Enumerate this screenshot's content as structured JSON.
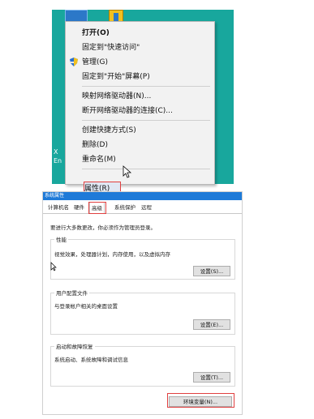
{
  "context_menu": {
    "items": [
      {
        "label": "打开(O)",
        "bold": true
      },
      {
        "label": "固定到\"快速访问\""
      },
      {
        "label": "管理(G)",
        "icon": "shield-icon"
      },
      {
        "label": "固定到\"开始\"屏幕(P)"
      },
      {
        "label": "映射网络驱动器(N)..."
      },
      {
        "label": "断开网络驱动器的连接(C)..."
      },
      {
        "label": "创建快捷方式(S)"
      },
      {
        "label": "删除(D)"
      },
      {
        "label": "重命名(M)"
      },
      {
        "label": "属性(R)",
        "highlighted": true
      }
    ]
  },
  "desktop": {
    "side_text_1": "X",
    "side_text_2": "En"
  },
  "dialog": {
    "title": "系统属性",
    "tabs": [
      {
        "label": "计算机名"
      },
      {
        "label": "硬件"
      },
      {
        "label": "高级",
        "active": true
      },
      {
        "label": "系统保护"
      },
      {
        "label": "远程"
      }
    ],
    "intro": "要进行大多数更改，你必须作为管理员登录。",
    "performance": {
      "title": "性能",
      "desc": "视觉效果，处理器计划，内存使用，以及虚拟内存",
      "button": "设置(S)..."
    },
    "user_profiles": {
      "title": "用户配置文件",
      "desc": "与登录帐户相关的桌面设置",
      "button": "设置(E)..."
    },
    "startup_recovery": {
      "title": "启动和故障恢复",
      "desc": "系统启动、系统故障和调试信息",
      "button": "设置(T)..."
    },
    "env_button": "环境变量(N)..."
  },
  "colors": {
    "desktop_bg": "#18a79d",
    "highlight_border": "#e04040",
    "title_bar": "#1e7ad8"
  }
}
